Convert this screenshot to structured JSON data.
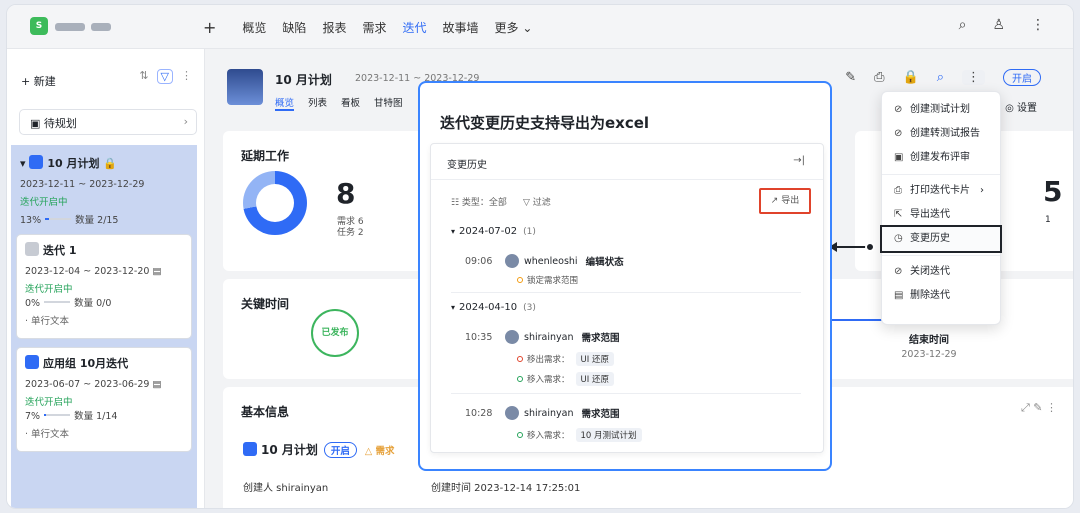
{
  "topnav": {
    "logo_letter": "S",
    "add": "+",
    "items": [
      "概览",
      "缺陷",
      "报表",
      "需求",
      "迭代",
      "故事墙",
      "更多 ⌄"
    ],
    "active_index": 4
  },
  "sidebar": {
    "new_label": "+ 新建",
    "pending_label": "待规划",
    "plan": {
      "title": "10 月计划",
      "dates": "2023-12-11 ~ 2023-12-29",
      "status": "迭代开启中",
      "progress": "13%",
      "progress_value": 0.13,
      "count": "数量 2/15"
    },
    "cards": [
      {
        "title": "迭代 1",
        "dates": "2023-12-04 ~ 2023-12-20",
        "status": "迭代开启中",
        "progress": "0%",
        "progress_value": 0,
        "count": "数量 0/0",
        "note": "· 单行文本"
      },
      {
        "title": "应用组 10月迭代",
        "dates": "2023-06-07 ~ 2023-06-29",
        "status": "迭代开启中",
        "progress": "7%",
        "progress_value": 0.07,
        "count": "数量 1/14",
        "note": "· 单行文本"
      }
    ]
  },
  "main": {
    "iter_title": "10 月计划",
    "iter_date": "2023-12-11 ~ 2023-12-29",
    "tabs": [
      "概览",
      "列表",
      "看板",
      "甘特图"
    ],
    "open_pill": "开启",
    "settings": "◎ 设置",
    "delay": {
      "title": "延期工作",
      "count": "8",
      "req": "需求 6",
      "task": "任务 2"
    },
    "key_time": {
      "title": "关键时间",
      "stamp": "已发布"
    },
    "end_label": "结束时间",
    "end_date": "2023-12-29",
    "basic": {
      "title": "基本信息",
      "name": "10 月计划",
      "badge": "开启",
      "warn": "△ 需求",
      "creator": "创建人   shirainyan",
      "ctime": "创建时间   2023-12-14 17:25:01"
    },
    "partial_number": "5",
    "partial_small": "1"
  },
  "menu": {
    "items": [
      {
        "icon": "⊘",
        "label": "创建测试计划"
      },
      {
        "icon": "⊘",
        "label": "创建转测试报告"
      },
      {
        "icon": "▣",
        "label": "创建发布评审"
      },
      {
        "icon": "⎙",
        "label": "打印迭代卡片"
      },
      {
        "icon": "⇱",
        "label": "导出迭代"
      },
      {
        "icon": "◷",
        "label": "变更历史"
      },
      {
        "icon": "⊘",
        "label": "关闭迭代"
      },
      {
        "icon": "▤",
        "label": "删除迭代"
      }
    ]
  },
  "callout": {
    "title": "迭代变更历史支持导出为excel",
    "panel_title": "变更历史",
    "collapse": "→|",
    "filter_type": "☷ 类型：全部",
    "filter": "▽ 过滤",
    "export": "↗ 导出",
    "groups": [
      {
        "date": "2024-07-02",
        "count": "(1)"
      },
      {
        "date": "2024-04-10",
        "count": "(3)"
      }
    ],
    "entries": [
      {
        "time": "09:06",
        "user": "whenleoshi",
        "action": "编辑状态",
        "sub": "锁定需求范围"
      },
      {
        "time": "10:35",
        "user": "shirainyan",
        "action": "需求范围",
        "subs": [
          {
            "label": "移出需求：",
            "tag": "UI 还原"
          },
          {
            "label": "移入需求：",
            "tag": "UI 还原"
          }
        ]
      },
      {
        "time": "10:28",
        "user": "shirainyan",
        "action": "需求范围",
        "subs": [
          {
            "label": "移入需求：",
            "tag": "10 月测试计划"
          }
        ]
      }
    ]
  }
}
